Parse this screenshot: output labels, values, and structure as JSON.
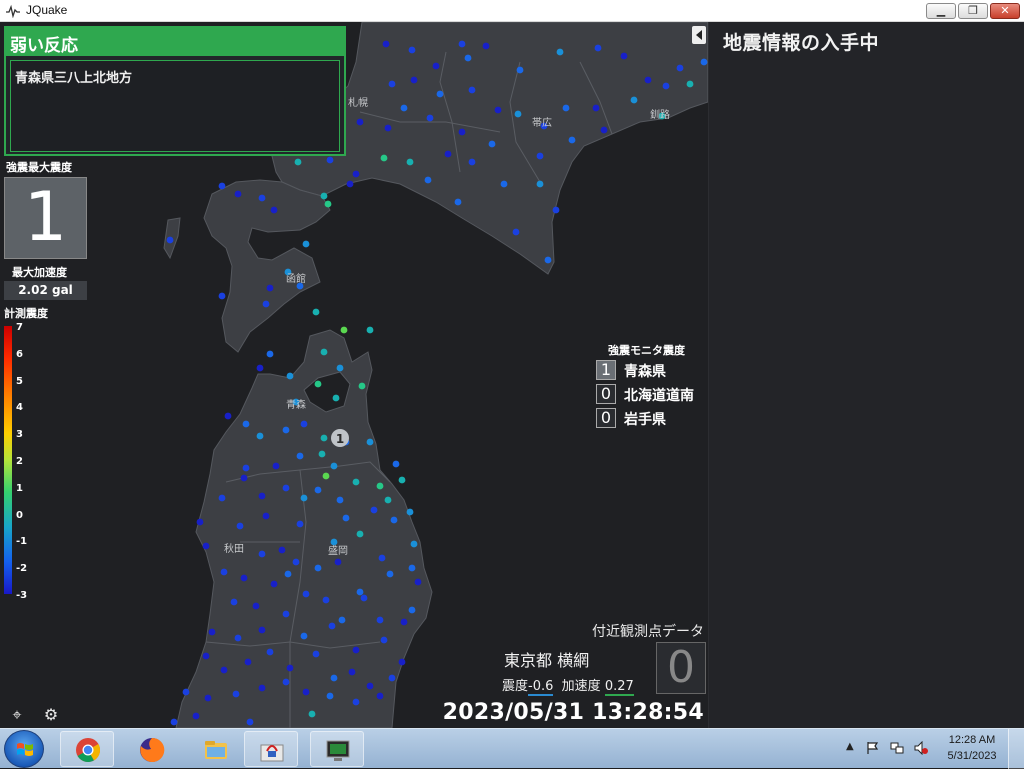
{
  "window": {
    "title": "JQuake"
  },
  "eew": {
    "status": "地震情報の入手中"
  },
  "alert": {
    "level": "弱い反応",
    "region": "青森県三八上北地方",
    "color": "#2fa84f"
  },
  "sidebar": {
    "max_intensity_label": "強震最大震度",
    "max_intensity_value": "1",
    "max_accel_label": "最大加速度",
    "max_accel_value": "2.02 gal",
    "scale_label": "計測震度",
    "scale_ticks": [
      "7",
      "6",
      "5",
      "4",
      "3",
      "2",
      "1",
      "0",
      "-1",
      "-2",
      "-3"
    ]
  },
  "map": {
    "cities": {
      "sapporo": "札幌",
      "obihiro": "帯広",
      "kushiro": "釧路",
      "hakodate": "函館",
      "aomori": "青森",
      "morioka": "盛岡",
      "akita": "秋田"
    },
    "epicenter_marker": "1",
    "land_color": "#3d3f44",
    "sea_color": "#1f2023"
  },
  "monitor": {
    "title": "強震モニタ震度",
    "rows": [
      {
        "value": "1",
        "name": "青森県"
      },
      {
        "value": "0",
        "name": "北海道道南"
      },
      {
        "value": "0",
        "name": "岩手県"
      }
    ]
  },
  "nearby": {
    "title": "付近観測点データ",
    "station": "東京都 横網",
    "intensity_label": "震度",
    "intensity_value": "-0.6",
    "accel_label": "加速度",
    "accel_value": "0.27",
    "intensity_int": "0"
  },
  "clock": "2023/05/31 13:28:54",
  "taskbar": {
    "items": [
      "chrome-icon",
      "firefox-icon",
      "explorer-icon",
      "java-icon",
      "monitor-app-icon"
    ],
    "time": "12:28 AM",
    "date": "5/31/2023"
  }
}
